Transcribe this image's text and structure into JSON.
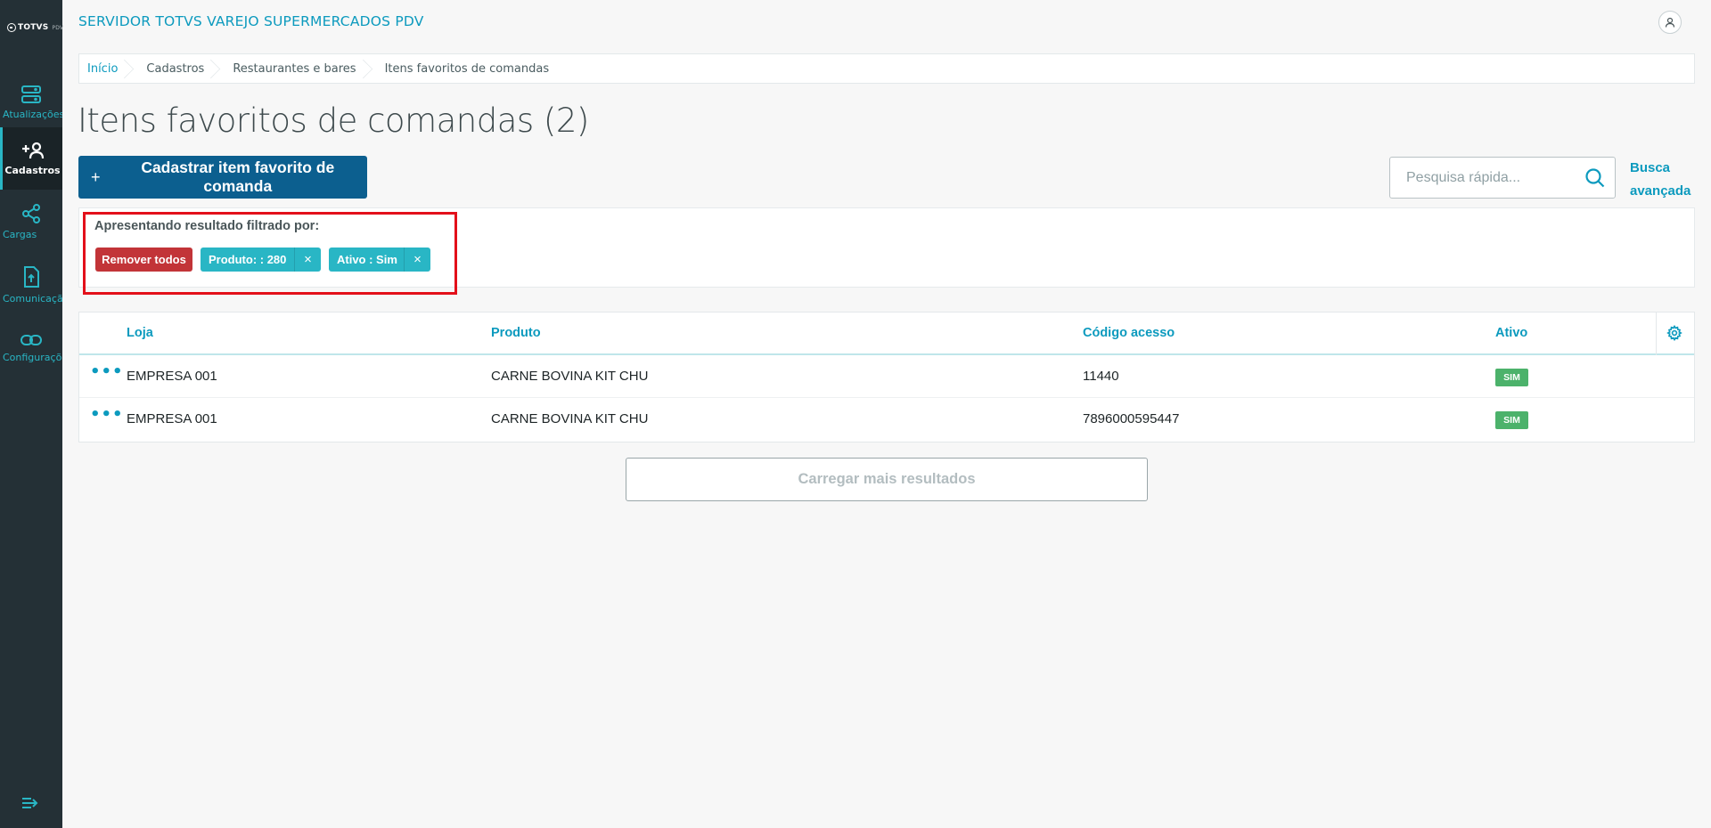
{
  "app": {
    "title": "SERVIDOR TOTVS VAREJO SUPERMERCADOS PDV",
    "logo_text": "TOTVS",
    "logo_sub": "PDV"
  },
  "colors": {
    "sidebar": "#243036",
    "accent": "#0c9abe",
    "primary_button": "#0c5f8f",
    "chip": "#29b6c5",
    "remove_all": "#c23438",
    "status_badge": "#4cb26b",
    "highlight": "#e3101a"
  },
  "sidebar": {
    "items": [
      {
        "label": "Atualizações",
        "icon": "server-icon",
        "active": false
      },
      {
        "label": "Cadastros",
        "icon": "add-user-icon",
        "active": true
      },
      {
        "label": "Cargas",
        "icon": "share-icon",
        "active": false
      },
      {
        "label": "Comunicação",
        "icon": "file-upload-icon",
        "active": false
      },
      {
        "label": "Configurações",
        "icon": "link-icon",
        "active": false
      }
    ],
    "collapse_icon": "menu-expand-icon"
  },
  "breadcrumb": [
    "Início",
    "Cadastros",
    "Restaurantes e bares",
    "Itens favoritos de comandas"
  ],
  "page": {
    "title": "Itens favoritos de comandas (2)",
    "primary_action": "Cadastrar item favorito de comanda",
    "primary_action_icon": "+"
  },
  "search": {
    "placeholder": "Pesquisa rápida...",
    "value": "",
    "advanced_line1": "Busca",
    "advanced_line2": "avançada"
  },
  "filters": {
    "label": "Apresentando resultado filtrado por:",
    "remove_all": "Remover todos",
    "chips": [
      {
        "label": "Produto: : 280",
        "close": "×"
      },
      {
        "label": "Ativo : Sim",
        "close": "×"
      }
    ]
  },
  "table": {
    "columns": [
      "Loja",
      "Produto",
      "Código acesso",
      "Ativo"
    ],
    "rows": [
      {
        "menu": "•••",
        "loja": "EMPRESA 001",
        "produto": "CARNE BOVINA KIT CHU",
        "codigo": "11440",
        "ativo": "SIM"
      },
      {
        "menu": "•••",
        "loja": "EMPRESA 001",
        "produto": "CARNE BOVINA KIT CHU",
        "codigo": "7896000595447",
        "ativo": "SIM"
      }
    ]
  },
  "load_more": "Carregar mais resultados"
}
